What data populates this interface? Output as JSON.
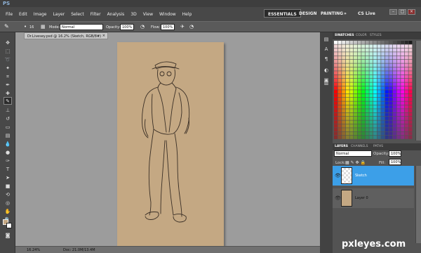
{
  "app": {
    "logo": "PS"
  },
  "menu": {
    "items": [
      "File",
      "Edit",
      "Image",
      "Layer",
      "Select",
      "Filter",
      "Analysis",
      "3D",
      "View",
      "Window",
      "Help"
    ]
  },
  "workspace": {
    "essentials": "ESSENTIALS",
    "design": "DESIGN",
    "painting": "PAINTING",
    "more": "»",
    "cslive": "CS Live"
  },
  "window": {
    "minimize": "–",
    "restore": "□",
    "close": "×"
  },
  "options": {
    "brush_size": "16",
    "mode_label": "Mode:",
    "mode_value": "Normal",
    "opacity_label": "Opacity:",
    "opacity_value": "100%",
    "flow_label": "Flow:",
    "flow_value": "100%"
  },
  "document": {
    "tab_title": "Dr.Livesey.psd @ 16.2% (Sketch, RGB/8#)",
    "close": "×"
  },
  "status": {
    "zoom": "16.24%",
    "doc": "Doc: 21.0M/13.4M"
  },
  "panels": {
    "swatches_tab": "SWATCHES",
    "color_tab": "COLOR",
    "styles_tab": "STYLES",
    "layers_tab": "LAYERS",
    "channels_tab": "CHANNELS",
    "paths_tab": "PATHS",
    "blend_mode": "Normal",
    "opacity_label": "Opacity:",
    "opacity_value": "100%",
    "lock_label": "Lock:",
    "fill_label": "Fill:",
    "fill_value": "100%",
    "layers": [
      {
        "name": "Sketch"
      },
      {
        "name": "Layer 0"
      }
    ]
  },
  "colors": {
    "canvas": "#c4a883",
    "selected_layer": "#3c9fe8"
  },
  "watermark": "pxleyes.com"
}
